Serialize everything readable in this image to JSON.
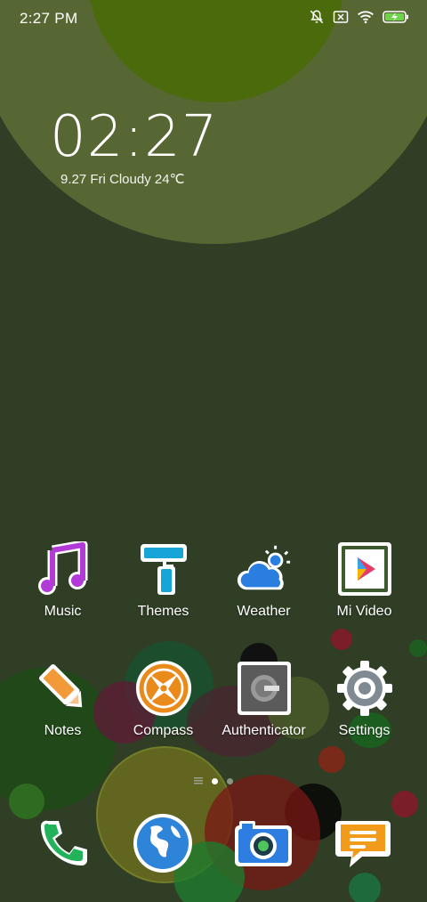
{
  "status_bar": {
    "time": "2:27  PM",
    "icons": [
      "notifications-off-icon",
      "no-sim-icon",
      "wifi-icon",
      "battery-charging-icon"
    ]
  },
  "clock_widget": {
    "time": "02:27",
    "weather_line": "9.27 Fri Cloudy 24℃"
  },
  "home": {
    "row1": [
      {
        "label": "Music",
        "icon": "music-note-icon"
      },
      {
        "label": "Themes",
        "icon": "paint-roller-icon"
      },
      {
        "label": "Weather",
        "icon": "cloud-sun-icon"
      },
      {
        "label": "Mi Video",
        "icon": "play-icon"
      }
    ],
    "row2": [
      {
        "label": "Notes",
        "icon": "pencil-icon"
      },
      {
        "label": "Compass",
        "icon": "compass-icon"
      },
      {
        "label": "Authenticator",
        "icon": "authenticator-icon"
      },
      {
        "label": "Settings",
        "icon": "gear-icon"
      }
    ],
    "page_indicator": {
      "pages": 3,
      "current": 2
    }
  },
  "dock": [
    {
      "app": "Phone",
      "icon": "phone-icon"
    },
    {
      "app": "Browser",
      "icon": "globe-icon"
    },
    {
      "app": "Camera",
      "icon": "camera-icon"
    },
    {
      "app": "Messages",
      "icon": "message-icon"
    }
  ],
  "colors": {
    "background": "#2f3e25",
    "arc": "#5a6b36",
    "arc_inner": "#4b6a0a"
  }
}
